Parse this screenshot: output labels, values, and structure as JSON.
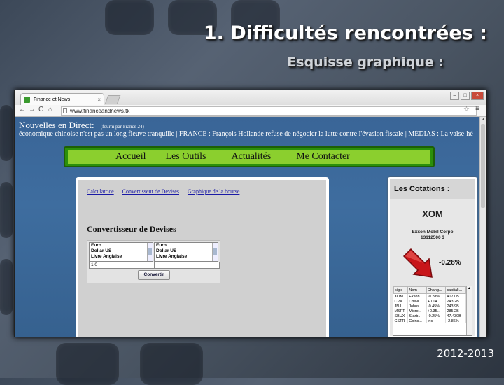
{
  "slide": {
    "title": "1.  Difficultés rencontrées :",
    "subtitle": "Esquisse graphique :",
    "year": "2012-2013"
  },
  "browser": {
    "tab_title": "Finance et News",
    "url": "www.financeandnews.tk"
  },
  "site": {
    "news_heading": "Nouvelles en Direct:",
    "news_note": "(fourni par France 24)",
    "ticker": "économique chinoise n'est pas un long fleuve tranquille | FRANCE : François Hollande refuse de négocier la lutte contre l'évasion fiscale | MÉDIAS : La valse-hé",
    "nav": [
      "Accueil",
      "Les Outils",
      "Actualités",
      "Me Contacter"
    ]
  },
  "converter": {
    "tabs": [
      "Calculatrice",
      "Convertisseur de Devises",
      "Graphique de la bourse"
    ],
    "title": "Convertisseur de Devises",
    "from_options": [
      "Euro",
      "Dollar US",
      "Livre Anglaise"
    ],
    "to_options": [
      "Euro",
      "Dollar US",
      "Livre Anglaise"
    ],
    "amount": "1.0",
    "button": "Convertir"
  },
  "quotes": {
    "title": "Les Cotations :",
    "symbol": "XOM",
    "company": "Exxon Mobil Corpo",
    "value": "13112500 $",
    "change": "-0.28%",
    "trend": "down",
    "columns": [
      "sigle",
      "Nom",
      "Chang...",
      "capitali..."
    ],
    "rows": [
      [
        "XOM",
        "Exxon...",
        "-0.28%",
        "407.0B"
      ],
      [
        "CVX",
        "Chevr...",
        "+0.04...",
        "243.2B"
      ],
      [
        "JNJ",
        "Johns...",
        "-0.45%",
        "243.9B"
      ],
      [
        "MSFT",
        "Micro...",
        "+0.35...",
        "285.2B"
      ],
      [
        "SBUX",
        "Starb...",
        "-0.25%",
        "47.439B"
      ],
      [
        "CSTR",
        "Coins...",
        "Inc",
        "-2.86%"
      ]
    ]
  }
}
